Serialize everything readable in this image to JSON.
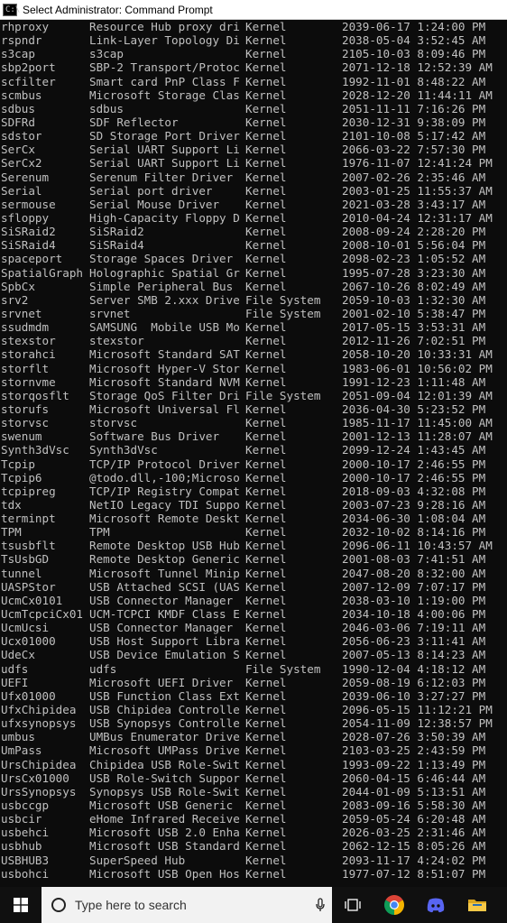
{
  "window": {
    "title": "Select Administrator: Command Prompt",
    "icon_label": "C:\\"
  },
  "console": {
    "rows": [
      [
        "rhproxy",
        "Resource Hub proxy dri",
        "Kernel",
        "2039-06-17 1:24:00 PM"
      ],
      [
        "rspndr",
        "Link-Layer Topology Di",
        "Kernel",
        "2038-05-04 3:52:45 AM"
      ],
      [
        "s3cap",
        "s3cap",
        "Kernel",
        "2105-10-03 8:09:46 PM"
      ],
      [
        "sbp2port",
        "SBP-2 Transport/Protoc",
        "Kernel",
        "2071-12-18 12:52:39 AM"
      ],
      [
        "scfilter",
        "Smart card PnP Class F",
        "Kernel",
        "1992-11-01 8:48:22 AM"
      ],
      [
        "scmbus",
        "Microsoft Storage Clas",
        "Kernel",
        "2028-12-20 11:44:11 AM"
      ],
      [
        "sdbus",
        "sdbus",
        "Kernel",
        "2051-11-11 7:16:26 PM"
      ],
      [
        "SDFRd",
        "SDF Reflector",
        "Kernel",
        "2030-12-31 9:38:09 PM"
      ],
      [
        "sdstor",
        "SD Storage Port Driver",
        "Kernel",
        "2101-10-08 5:17:42 AM"
      ],
      [
        "SerCx",
        "Serial UART Support Li",
        "Kernel",
        "2066-03-22 7:57:30 PM"
      ],
      [
        "SerCx2",
        "Serial UART Support Li",
        "Kernel",
        "1976-11-07 12:41:24 PM"
      ],
      [
        "Serenum",
        "Serenum Filter Driver",
        "Kernel",
        "2007-02-26 2:35:46 AM"
      ],
      [
        "Serial",
        "Serial port driver",
        "Kernel",
        "2003-01-25 11:55:37 AM"
      ],
      [
        "sermouse",
        "Serial Mouse Driver",
        "Kernel",
        "2021-03-28 3:43:17 AM"
      ],
      [
        "sfloppy",
        "High-Capacity Floppy D",
        "Kernel",
        "2010-04-24 12:31:17 AM"
      ],
      [
        "SiSRaid2",
        "SiSRaid2",
        "Kernel",
        "2008-09-24 2:28:20 PM"
      ],
      [
        "SiSRaid4",
        "SiSRaid4",
        "Kernel",
        "2008-10-01 5:56:04 PM"
      ],
      [
        "spaceport",
        "Storage Spaces Driver",
        "Kernel",
        "2098-02-23 1:05:52 AM"
      ],
      [
        "SpatialGraph",
        "Holographic Spatial Gr",
        "Kernel",
        "1995-07-28 3:23:30 AM"
      ],
      [
        "SpbCx",
        "Simple Peripheral Bus",
        "Kernel",
        "2067-10-26 8:02:49 AM"
      ],
      [
        "srv2",
        "Server SMB 2.xxx Drive",
        "File System",
        "2059-10-03 1:32:30 AM"
      ],
      [
        "srvnet",
        "srvnet",
        "File System",
        "2001-02-10 5:38:47 PM"
      ],
      [
        "ssudmdm",
        "SAMSUNG  Mobile USB Mo",
        "Kernel",
        "2017-05-15 3:53:31 AM"
      ],
      [
        "stexstor",
        "stexstor",
        "Kernel",
        "2012-11-26 7:02:51 PM"
      ],
      [
        "storahci",
        "Microsoft Standard SAT",
        "Kernel",
        "2058-10-20 10:33:31 AM"
      ],
      [
        "storflt",
        "Microsoft Hyper-V Stor",
        "Kernel",
        "1983-06-01 10:56:02 PM"
      ],
      [
        "stornvme",
        "Microsoft Standard NVM",
        "Kernel",
        "1991-12-23 1:11:48 AM"
      ],
      [
        "storqosflt",
        "Storage QoS Filter Dri",
        "File System",
        "2051-09-04 12:01:39 AM"
      ],
      [
        "storufs",
        "Microsoft Universal Fl",
        "Kernel",
        "2036-04-30 5:23:52 PM"
      ],
      [
        "storvsc",
        "storvsc",
        "Kernel",
        "1985-11-17 11:45:00 AM"
      ],
      [
        "swenum",
        "Software Bus Driver",
        "Kernel",
        "2001-12-13 11:28:07 AM"
      ],
      [
        "Synth3dVsc",
        "Synth3dVsc",
        "Kernel",
        "2099-12-24 1:43:45 AM"
      ],
      [
        "Tcpip",
        "TCP/IP Protocol Driver",
        "Kernel",
        "2000-10-17 2:46:55 PM"
      ],
      [
        "Tcpip6",
        "@todo.dll,-100;Microso",
        "Kernel",
        "2000-10-17 2:46:55 PM"
      ],
      [
        "tcpipreg",
        "TCP/IP Registry Compat",
        "Kernel",
        "2018-09-03 4:32:08 PM"
      ],
      [
        "tdx",
        "NetIO Legacy TDI Suppo",
        "Kernel",
        "2003-07-23 9:28:16 AM"
      ],
      [
        "terminpt",
        "Microsoft Remote Deskt",
        "Kernel",
        "2034-06-30 1:08:04 AM"
      ],
      [
        "TPM",
        "TPM",
        "Kernel",
        "2032-10-02 8:14:16 PM"
      ],
      [
        "tsusbflt",
        "Remote Desktop USB Hub",
        "Kernel",
        "2096-06-11 10:43:57 AM"
      ],
      [
        "TsUsbGD",
        "Remote Desktop Generic",
        "Kernel",
        "2001-08-03 7:41:51 AM"
      ],
      [
        "tunnel",
        "Microsoft Tunnel Minip",
        "Kernel",
        "2047-08-20 8:32:00 AM"
      ],
      [
        "UASPStor",
        "USB Attached SCSI (UAS",
        "Kernel",
        "2007-12-09 7:07:17 PM"
      ],
      [
        "UcmCx0101",
        "USB Connector Manager",
        "Kernel",
        "2038-03-10 1:19:00 PM"
      ],
      [
        "UcmTcpciCx01",
        "UCM-TCPCI KMDF Class E",
        "Kernel",
        "2034-10-18 4:00:06 PM"
      ],
      [
        "UcmUcsi",
        "USB Connector Manager",
        "Kernel",
        "2046-03-06 7:19:11 AM"
      ],
      [
        "Ucx01000",
        "USB Host Support Libra",
        "Kernel",
        "2056-06-23 3:11:41 AM"
      ],
      [
        "UdeCx",
        "USB Device Emulation S",
        "Kernel",
        "2007-05-13 8:14:23 AM"
      ],
      [
        "udfs",
        "udfs",
        "File System",
        "1990-12-04 4:18:12 AM"
      ],
      [
        "UEFI",
        "Microsoft UEFI Driver",
        "Kernel",
        "2059-08-19 6:12:03 PM"
      ],
      [
        "Ufx01000",
        "USB Function Class Ext",
        "Kernel",
        "2039-06-10 3:27:27 PM"
      ],
      [
        "UfxChipidea",
        "USB Chipidea Controlle",
        "Kernel",
        "2096-05-15 11:12:21 PM"
      ],
      [
        "ufxsynopsys",
        "USB Synopsys Controlle",
        "Kernel",
        "2054-11-09 12:38:57 PM"
      ],
      [
        "umbus",
        "UMBus Enumerator Drive",
        "Kernel",
        "2028-07-26 3:50:39 AM"
      ],
      [
        "UmPass",
        "Microsoft UMPass Drive",
        "Kernel",
        "2103-03-25 2:43:59 PM"
      ],
      [
        "UrsChipidea",
        "Chipidea USB Role-Swit",
        "Kernel",
        "1993-09-22 1:13:49 PM"
      ],
      [
        "UrsCx01000",
        "USB Role-Switch Suppor",
        "Kernel",
        "2060-04-15 6:46:44 AM"
      ],
      [
        "UrsSynopsys",
        "Synopsys USB Role-Swit",
        "Kernel",
        "2044-01-09 5:13:51 AM"
      ],
      [
        "usbccgp",
        "Microsoft USB Generic",
        "Kernel",
        "2083-09-16 5:58:30 AM"
      ],
      [
        "usbcir",
        "eHome Infrared Receive",
        "Kernel",
        "2059-05-24 6:20:48 AM"
      ],
      [
        "usbehci",
        "Microsoft USB 2.0 Enha",
        "Kernel",
        "2026-03-25 2:31:46 AM"
      ],
      [
        "usbhub",
        "Microsoft USB Standard",
        "Kernel",
        "2062-12-15 8:05:26 AM"
      ],
      [
        "USBHUB3",
        "SuperSpeed Hub",
        "Kernel",
        "2093-11-17 4:24:02 PM"
      ],
      [
        "usbohci",
        "Microsoft USB Open Hos",
        "Kernel",
        "1977-07-12 8:51:07 PM"
      ]
    ]
  },
  "taskbar": {
    "search_placeholder": "Type here to search"
  },
  "colors": {
    "console_bg": "#0c0c0c",
    "console_text": "#c0c0c0",
    "taskbar_bg": "#101010",
    "chrome_red": "#db4437",
    "chrome_yellow": "#f4b400",
    "chrome_green": "#0f9d58",
    "chrome_blue": "#4285f4",
    "discord": "#5865f2",
    "folder": "#f7c948"
  }
}
